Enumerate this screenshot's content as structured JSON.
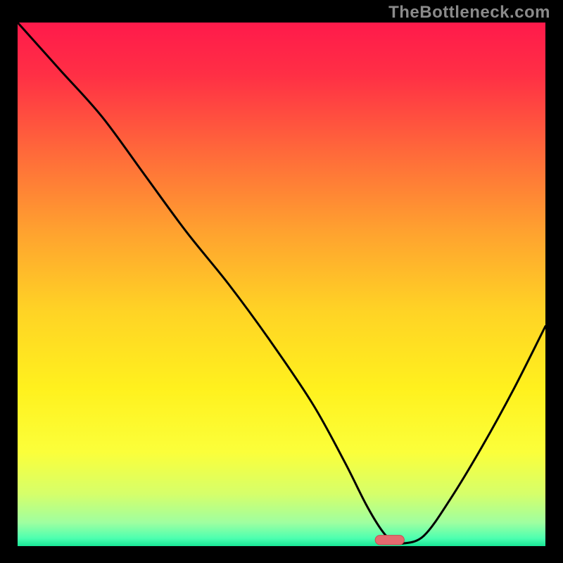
{
  "watermark": "TheBottleneck.com",
  "colors": {
    "gradient": [
      {
        "offset": 0.0,
        "color": "#ff1a4b"
      },
      {
        "offset": 0.1,
        "color": "#ff2f45"
      },
      {
        "offset": 0.25,
        "color": "#ff6a3a"
      },
      {
        "offset": 0.4,
        "color": "#ffa22f"
      },
      {
        "offset": 0.55,
        "color": "#ffd325"
      },
      {
        "offset": 0.7,
        "color": "#fff11e"
      },
      {
        "offset": 0.82,
        "color": "#fbff3a"
      },
      {
        "offset": 0.9,
        "color": "#d6ff6a"
      },
      {
        "offset": 0.955,
        "color": "#9fffa0"
      },
      {
        "offset": 0.985,
        "color": "#4dffb0"
      },
      {
        "offset": 1.0,
        "color": "#19e696"
      }
    ],
    "marker_fill": "#e46a6f",
    "marker_stroke": "#c94b52"
  },
  "chart_data": {
    "type": "line",
    "title": "",
    "xlabel": "",
    "ylabel": "",
    "xlim": [
      0,
      100
    ],
    "ylim": [
      0,
      100
    ],
    "grid": false,
    "legend": false,
    "series": [
      {
        "name": "bottleneck",
        "x": [
          0,
          8,
          16,
          24,
          32,
          40,
          48,
          56,
          62,
          66,
          69,
          71,
          73,
          77,
          82,
          88,
          94,
          100
        ],
        "y": [
          100,
          91,
          82,
          71,
          60,
          50,
          39,
          27,
          16,
          8,
          3,
          1,
          0.5,
          2,
          9,
          19,
          30,
          42
        ]
      }
    ],
    "marker": {
      "x_center": 70.5,
      "width": 5.5,
      "height": 1.8
    }
  }
}
